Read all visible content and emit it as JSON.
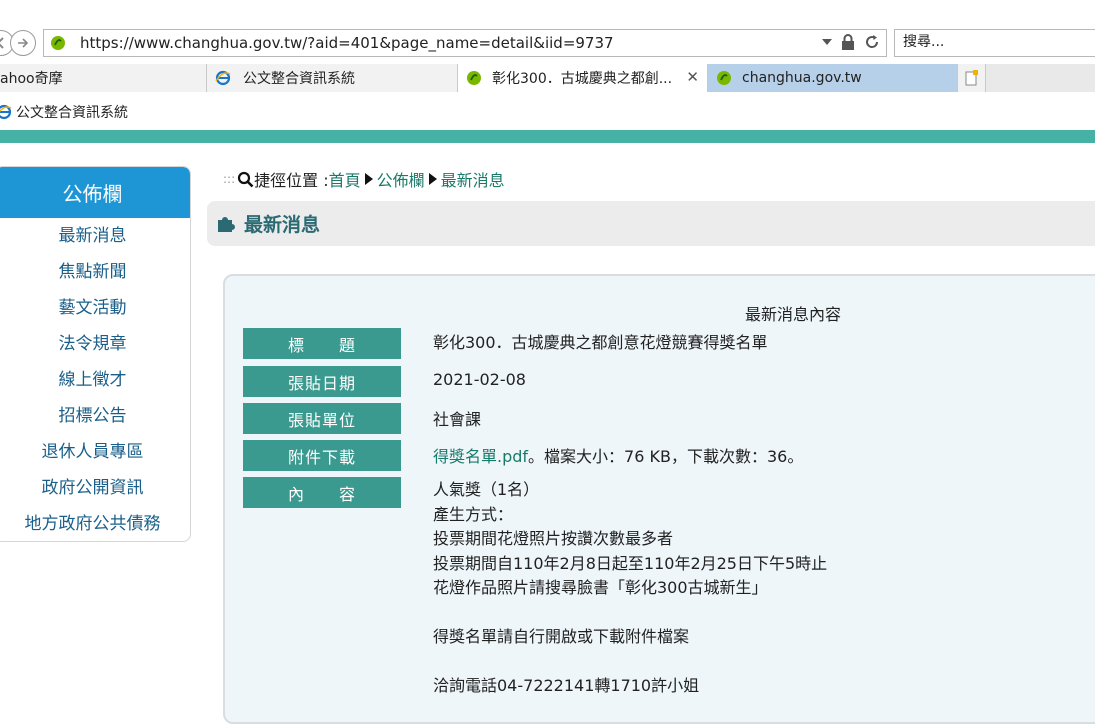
{
  "browser": {
    "url": "https://www.changhua.gov.tw/?aid=401&page_name=detail&iid=9737",
    "search_placeholder": "搜尋...",
    "tabs": [
      {
        "label": "ahoo奇摩"
      },
      {
        "label": "公文整合資訊系統"
      },
      {
        "label": "彰化300．古城慶典之都創..."
      },
      {
        "label": "changhua.gov.tw"
      }
    ],
    "favorites": [
      {
        "label": "公文整合資訊系統"
      }
    ]
  },
  "sidebar": {
    "title": "公佈欄",
    "items": [
      {
        "label": "最新消息"
      },
      {
        "label": "焦點新聞"
      },
      {
        "label": "藝文活動"
      },
      {
        "label": "法令規章"
      },
      {
        "label": "線上徵才"
      },
      {
        "label": "招標公告"
      },
      {
        "label": "退休人員專區"
      },
      {
        "label": "政府公開資訊"
      },
      {
        "label": "地方政府公共債務"
      }
    ]
  },
  "breadcrumb": {
    "prefix": "捷徑位置 : ",
    "items": [
      "首頁",
      "公佈欄",
      "最新消息"
    ]
  },
  "section": {
    "title": "最新消息"
  },
  "detail": {
    "heading": "最新消息內容",
    "fields": {
      "title_label": "標　　題",
      "title_value": "彰化300．古城慶典之都創意花燈競賽得獎名單",
      "date_label": "張貼日期",
      "date_value": "2021-02-08",
      "unit_label": "張貼單位",
      "unit_value": "社會課",
      "attach_label": "附件下載",
      "attach_link": "得獎名單.pdf",
      "attach_info": "。檔案大小：76 KB，下載次數：36。",
      "content_label": "內　　容"
    },
    "content_lines": [
      "人氣獎（1名）",
      "產生方式：",
      "投票期間花燈照片按讚次數最多者",
      "投票期間自110年2月8日起至110年2月25日下午5時止",
      "花燈作品照片請搜尋臉書「彰化300古城新生」",
      "",
      "得獎名單請自行開啟或下載附件檔案",
      "",
      "洽詢電話04-7222141轉1710許小姐"
    ]
  }
}
